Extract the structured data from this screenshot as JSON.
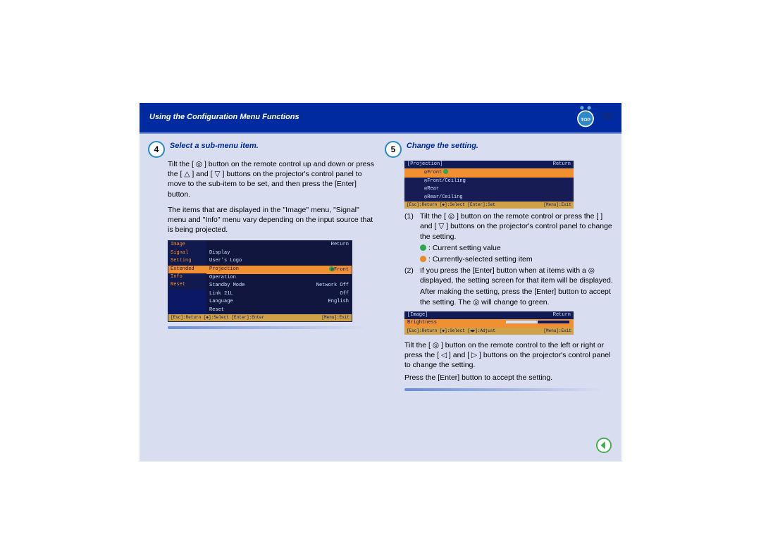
{
  "header": {
    "title": "Using the Configuration Menu Functions",
    "page_number": "70"
  },
  "step4": {
    "number": "4",
    "title": "Select a sub-menu item.",
    "para1": "Tilt the [ ◎ ] button on the remote control up and down or press the [ △ ] and [ ▽ ] buttons on the projector's control panel to move to the sub-item to be set, and then press the [Enter] button.",
    "para2": "The items that are displayed in the \"Image\" menu, \"Signal\" menu and \"Info\" menu vary depending on the input source that is being projected."
  },
  "osd1": {
    "side": [
      "Image",
      "Signal",
      "Setting",
      "Extended",
      "Info",
      "Reset"
    ],
    "side_selected": "Extended",
    "return": "Return",
    "rows": [
      {
        "l": "Display",
        "r": ""
      },
      {
        "l": "User's Logo",
        "r": ""
      },
      {
        "l": "Projection",
        "r": "◎Front",
        "hl": true
      },
      {
        "l": "Operation",
        "r": ""
      },
      {
        "l": "Standby Mode",
        "r": "Network Off"
      },
      {
        "l": "Link 21L",
        "r": "Off"
      },
      {
        "l": "Language",
        "r": "English"
      },
      {
        "l": "Reset",
        "r": ""
      }
    ],
    "bottom_left": "[Esc]:Return  [◆]:Select  [Enter]:Enter",
    "bottom_right": "[Menu]:Exit"
  },
  "step5": {
    "number": "5",
    "title": "Change the setting."
  },
  "osd2": {
    "top_left": "[Projection]",
    "top_right": "Return",
    "options": [
      "◎Front",
      "◎Front/Ceiling",
      "◎Rear",
      "◎Rear/Ceiling"
    ],
    "selected": "◎Front",
    "bottom_left": "[Esc]:Return  [◆]:Select  [Enter]:Set",
    "bottom_right": "[Menu]:Exit"
  },
  "step5_list": {
    "item1": "Tilt the [ ◎ ] button on the remote control or press the [   ] and [ ▽ ] buttons on the projector's control panel to change the setting.",
    "legend_green": ": Current setting value",
    "legend_orange": ": Currently-selected setting item",
    "item2": "If you press the [Enter] button when at items with a ◎ displayed, the setting screen for that item will be displayed.",
    "item2b": "After making the setting, press the [Enter] button to accept the setting. The ◎ will change to green."
  },
  "osd3": {
    "top_left": "[Image]",
    "top_right": "Return",
    "slider_label": "Brightness",
    "bottom_left": "[Esc]:Return  [◆]:Select  [◀▶]:Adjust",
    "bottom_right": "[Menu]:Exit"
  },
  "tail": {
    "p1": "Tilt the [ ◎ ] button on the remote control to the left or right or press the [ ◁ ] and [ ▷ ] buttons on the projector's control panel to change the setting.",
    "p2": "Press the [Enter] button to accept the setting."
  }
}
